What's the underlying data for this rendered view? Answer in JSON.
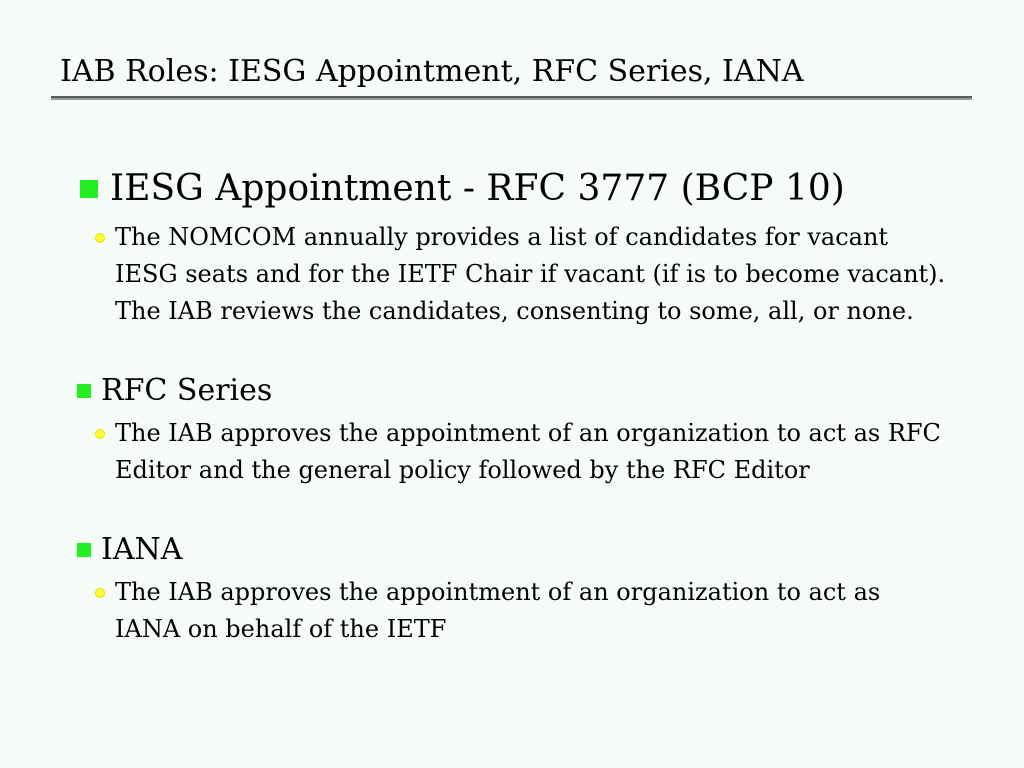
{
  "slide": {
    "title": "IAB Roles: IESG Appointment, RFC Series, IANA",
    "sections": [
      {
        "heading": "IESG Appointment - RFC 3777 (BCP 10)",
        "lines": [
          "The NOMCOM annually provides a list of candidates for vacant",
          "IESG seats and for the IETF Chair if vacant (if is to become vacant).",
          "The IAB reviews the candidates, consenting to some, all, or none."
        ]
      },
      {
        "heading": "RFC Series",
        "lines": [
          "The IAB approves the appointment of an organization to act as RFC",
          "Editor and the general policy followed by the RFC Editor"
        ]
      },
      {
        "heading": "IANA",
        "lines": [
          "The IAB approves the appointment of an organization to act as",
          "IANA on behalf of the IETF"
        ]
      }
    ]
  },
  "colors": {
    "background": "#f5fbf7",
    "square_bullet": "#22ee22",
    "round_bullet": "#ffff33",
    "title_rule": "#5a5a5a"
  }
}
